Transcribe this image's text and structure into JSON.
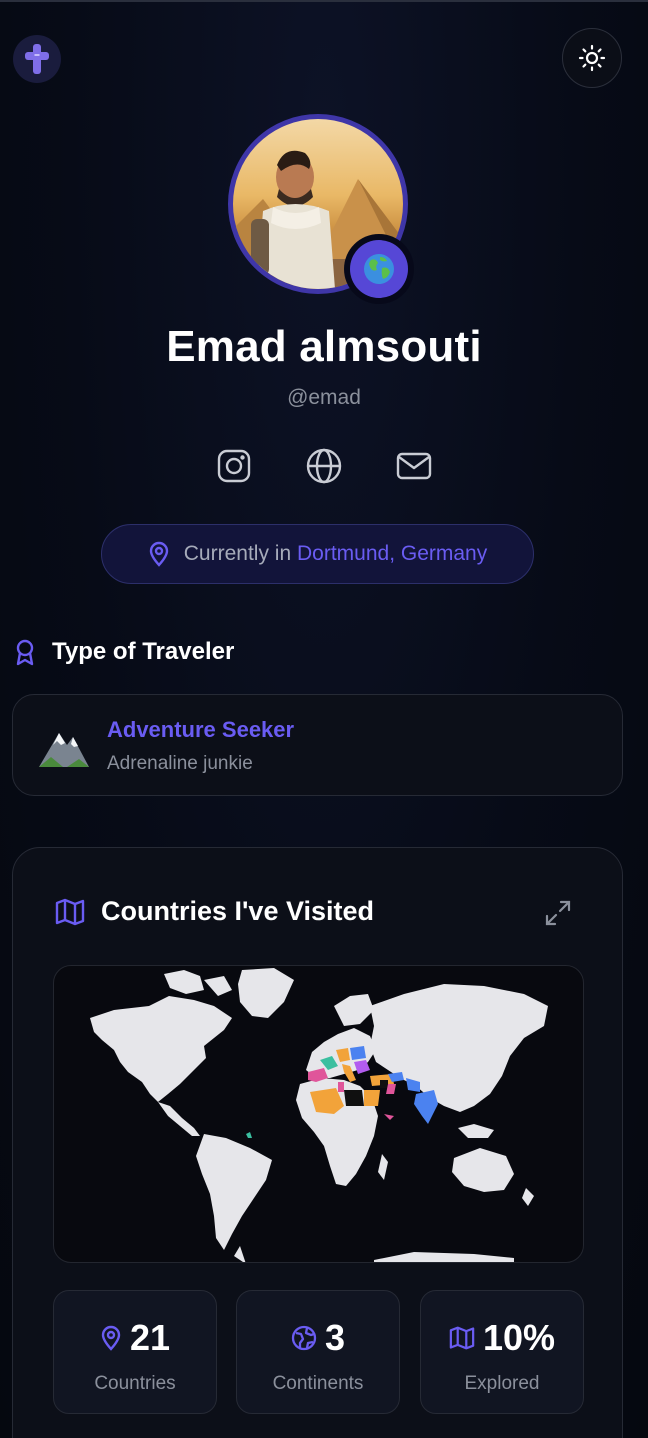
{
  "header": {
    "logo_icon": "cross-logo-icon",
    "theme_toggle_icon": "sun-icon"
  },
  "profile": {
    "name": "Emad almsouti",
    "handle": "@emad",
    "avatar_badge_icon": "globe-emoji-icon",
    "social_links": [
      "instagram-icon",
      "globe-icon",
      "mail-icon"
    ],
    "location_prefix": "Currently in",
    "location_city": "Dortmund, Germany"
  },
  "traveler": {
    "section_title": "Type of Traveler",
    "section_icon": "award-ribbon-icon",
    "type_title": "Adventure Seeker",
    "type_subtitle": "Adrenaline junkie",
    "type_icon": "mountain-emoji-icon"
  },
  "visited": {
    "section_title": "Countries I've Visited",
    "section_icon": "map-icon",
    "expand_icon": "expand-icon",
    "stats": [
      {
        "value": "21",
        "label": "Countries",
        "icon": "map-pin-icon"
      },
      {
        "value": "3",
        "label": "Continents",
        "icon": "earth-icon"
      },
      {
        "value": "10%",
        "label": "Explored",
        "icon": "map-icon"
      }
    ]
  },
  "colors": {
    "accent": "#6a5cf2",
    "background": "#060a15",
    "card": "#0c0f18",
    "land": "#e6e6ea",
    "visited_orange": "#f2a33a",
    "visited_blue": "#4b82f0",
    "visited_pink": "#e0559a",
    "visited_teal": "#3bbfa0"
  }
}
